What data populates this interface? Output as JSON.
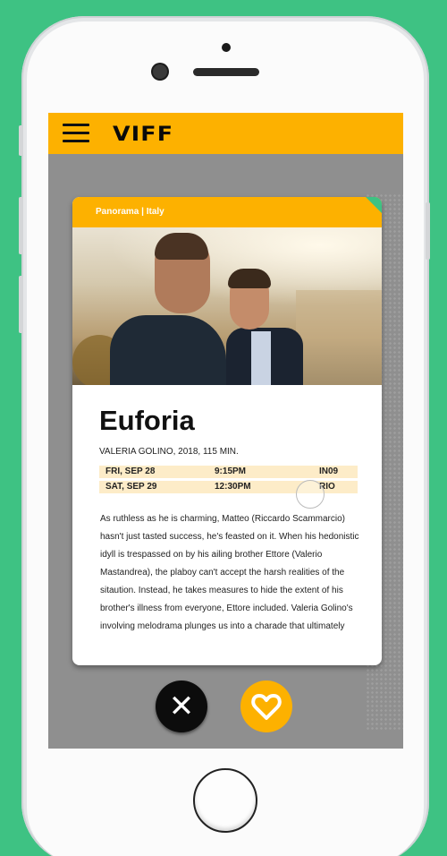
{
  "app": {
    "logo": "VIFF"
  },
  "colors": {
    "accent": "#fdb100",
    "background": "#3ec283",
    "screen_bg": "#8f8f8f",
    "showtime_row": "#fdecc8"
  },
  "film": {
    "category": "Panorama | Italy",
    "title": "Euforia",
    "meta": "VALERIA GOLINO, 2018, 115 MIN.",
    "showtimes": [
      {
        "date": "FRI, SEP 28",
        "time": "9:15PM",
        "venue": "IN09"
      },
      {
        "date": "SAT, SEP 29",
        "time": "12:30PM",
        "venue": "RIO"
      }
    ],
    "synopsis": "As ruthless as he is charming, Matteo (Riccardo Scammarcio) hasn't just tasted success, he's feasted on it. When his hedonistic idyll is trespassed on by his ailing brother Ettore (Valerio Mastandrea), the plaboy can't accept the harsh realities of the sitaution. Instead, he takes measures to hide the extent of his brother's illness from everyone, Ettore included. Valeria Golino's involving melodrama plunges us into a charade that ultimately"
  },
  "actions": {
    "dismiss_icon": "close-icon",
    "favorite_icon": "heart-icon"
  },
  "icons": {
    "menu": "hamburger-icon"
  }
}
